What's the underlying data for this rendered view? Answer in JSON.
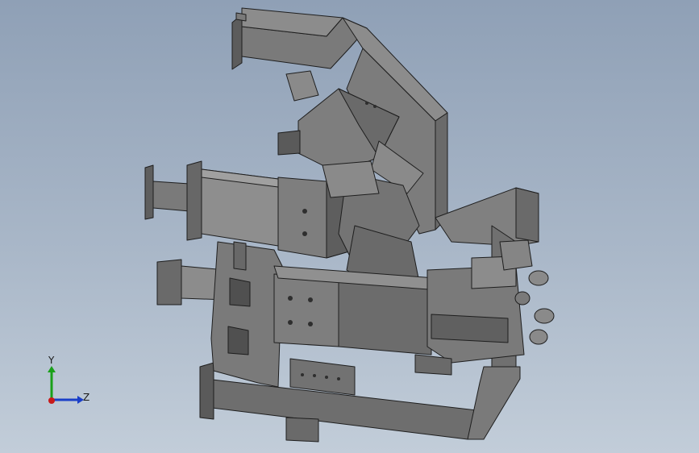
{
  "viewport": {
    "background_top": "#8fa0b6",
    "background_bottom": "#c2cdd9",
    "model_color": "#6e6e6e",
    "edge_color": "#1e1e1e"
  },
  "triad": {
    "y_label": "Y",
    "z_label": "Z",
    "y_color": "#1aa01a",
    "z_color": "#1a3fc8",
    "x_color": "#c81a1a"
  }
}
